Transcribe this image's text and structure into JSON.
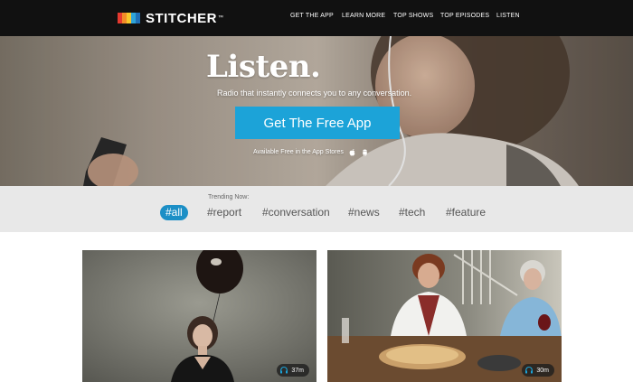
{
  "brand": {
    "name": "STITCHER",
    "trademark": "™",
    "bar_colors": [
      "#e5392f",
      "#f28c28",
      "#f7c72b",
      "#2ea4d8",
      "#1f6fb6"
    ]
  },
  "nav": {
    "items": [
      "GET THE APP",
      "LEARN MORE",
      "TOP SHOWS",
      "TOP EPISODES",
      "LISTEN"
    ]
  },
  "hero": {
    "title": "Listen.",
    "subtitle": "Radio that instantly connects you to any conversation.",
    "cta_label": "Get The Free App",
    "stores_text": "Available Free in the App Stores",
    "store_icons": [
      "apple-icon",
      "android-icon"
    ]
  },
  "trending": {
    "label": "Trending Now:",
    "tags": [
      "#all",
      "#report",
      "#conversation",
      "#news",
      "#tech",
      "#feature"
    ],
    "active_tag": "#all"
  },
  "cards": [
    {
      "duration": "37m",
      "icon": "headphones-icon"
    },
    {
      "duration": "30m",
      "icon": "headphones-icon"
    }
  ],
  "colors": {
    "accent": "#1ca3d8",
    "active_tag": "#1c8fc6",
    "nav_bg": "#111111",
    "trending_bg": "#e8e8e8"
  }
}
